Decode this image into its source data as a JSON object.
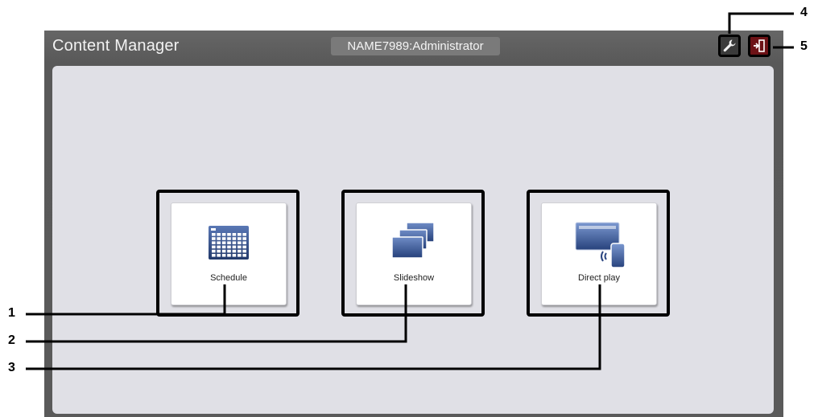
{
  "app": {
    "title": "Content Manager",
    "user": "NAME7989:Administrator"
  },
  "toolbar": {
    "settings_icon": "wrench-icon",
    "logout_icon": "logout-door-icon"
  },
  "tiles": [
    {
      "label": "Schedule",
      "icon": "calendar-grid-icon"
    },
    {
      "label": "Slideshow",
      "icon": "stacked-screens-icon"
    },
    {
      "label": "Direct play",
      "icon": "display-with-phone-icon"
    }
  ],
  "callouts": [
    "1",
    "2",
    "3",
    "4",
    "5"
  ],
  "colors": {
    "titlebar": "#5c5c5c",
    "panel": "#e0e0e6",
    "icon_blue": "#2f4f8a",
    "logout": "#6d1216"
  }
}
